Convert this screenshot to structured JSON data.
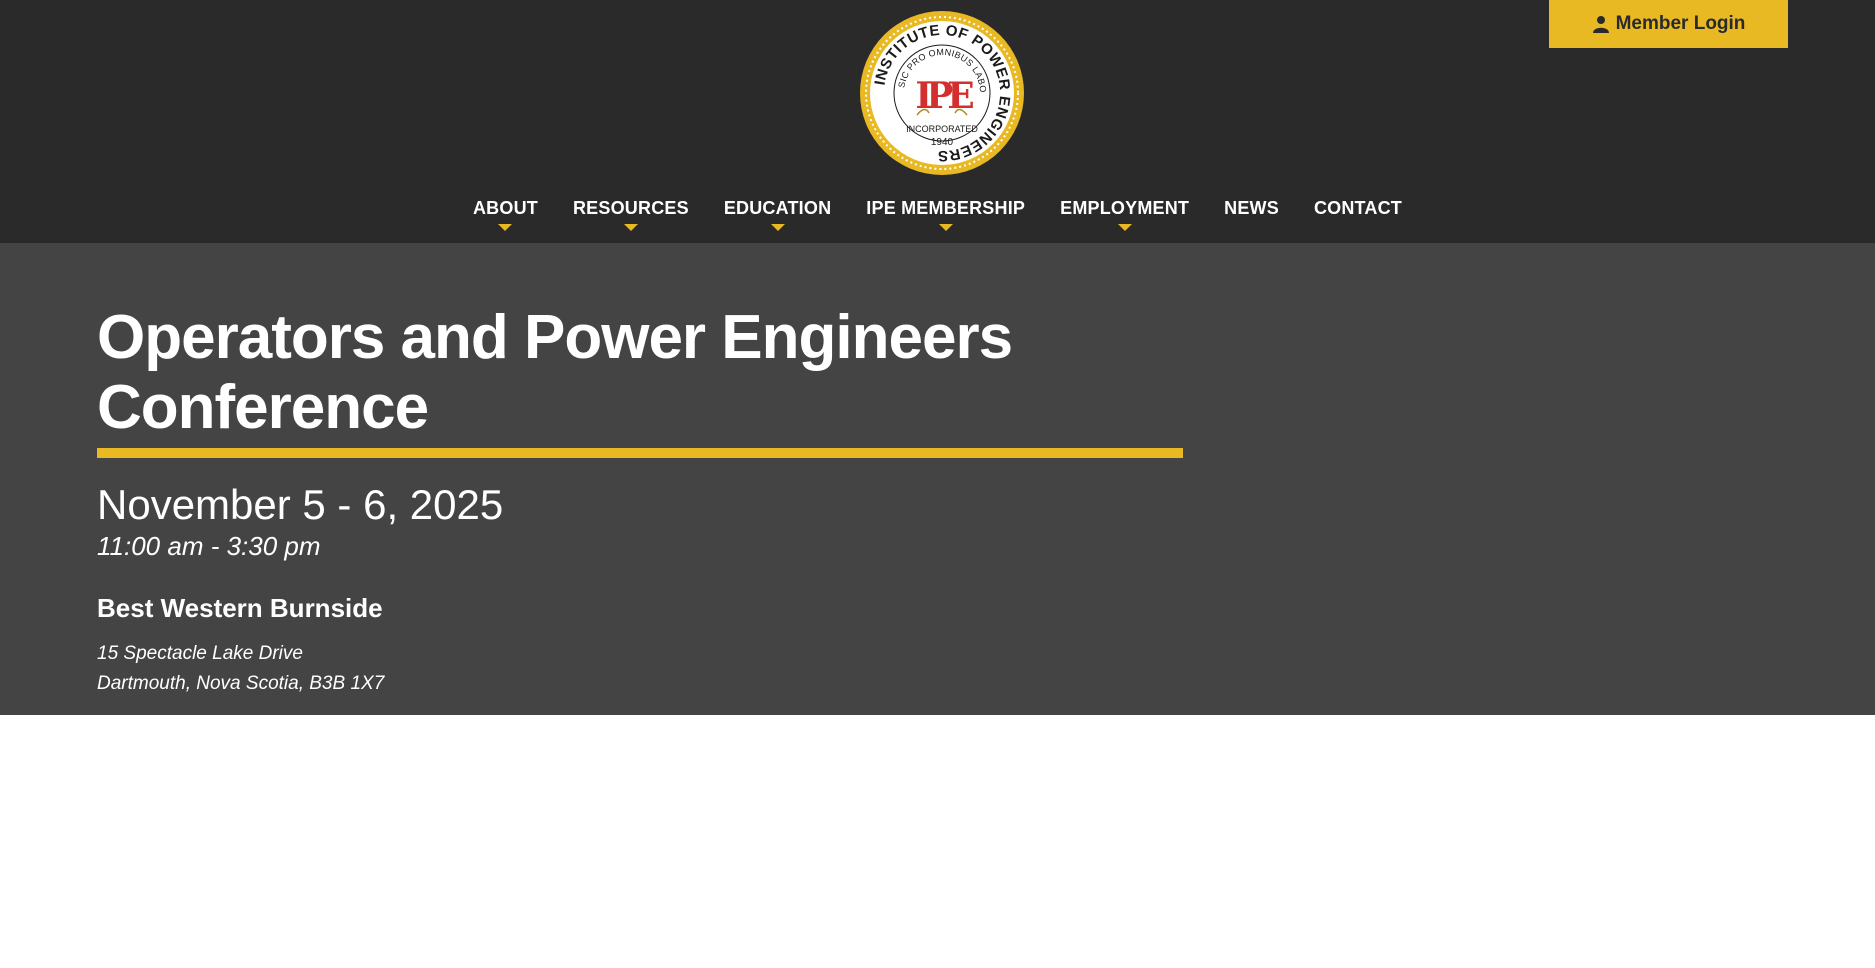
{
  "site": {
    "logo": {
      "ring_text": "INSTITUTE OF POWER ENGINEERS",
      "motto": "SIC PRO OMNIBUS LABORAS",
      "monogram": "IPE",
      "incorporated": "INCORPORATED",
      "year": "1940"
    },
    "member_login": {
      "label": "Member Login",
      "icon": "user-icon"
    }
  },
  "nav": {
    "items": [
      {
        "label": "ABOUT",
        "has_dropdown": true
      },
      {
        "label": "RESOURCES",
        "has_dropdown": true
      },
      {
        "label": "EDUCATION",
        "has_dropdown": true
      },
      {
        "label": "IPE MEMBERSHIP",
        "has_dropdown": true
      },
      {
        "label": "EMPLOYMENT",
        "has_dropdown": true
      },
      {
        "label": "NEWS",
        "has_dropdown": false
      },
      {
        "label": "CONTACT",
        "has_dropdown": false
      }
    ]
  },
  "event": {
    "title": "Operators and Power Engineers Conference",
    "date": "November 5 - 6, 2025",
    "time": "11:00 am - 3:30 pm",
    "venue": "Best Western Burnside",
    "address_line1": "15 Spectacle Lake Drive",
    "address_line2": "Dartmouth, Nova Scotia, B3B 1X7"
  },
  "colors": {
    "header_bg": "#2a2a2a",
    "hero_bg": "#444444",
    "accent": "#e9b924",
    "monogram_red": "#d32f2f",
    "text": "#ffffff"
  }
}
